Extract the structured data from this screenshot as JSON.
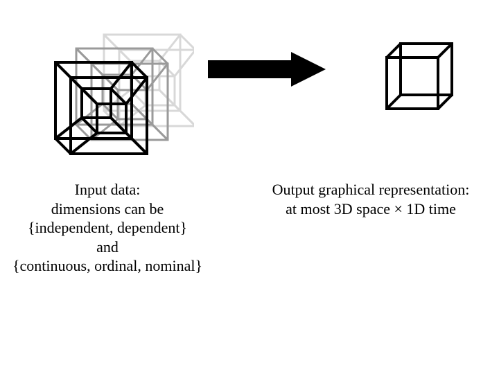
{
  "input_caption": {
    "l1": "Input data:",
    "l2": "dimensions can be",
    "l3": "{independent, dependent}",
    "l4": "and",
    "l5": "{continuous, ordinal, nominal}"
  },
  "output_caption": {
    "l1": "Output graphical representation:",
    "l2": "at most 3D space × 1D time"
  }
}
